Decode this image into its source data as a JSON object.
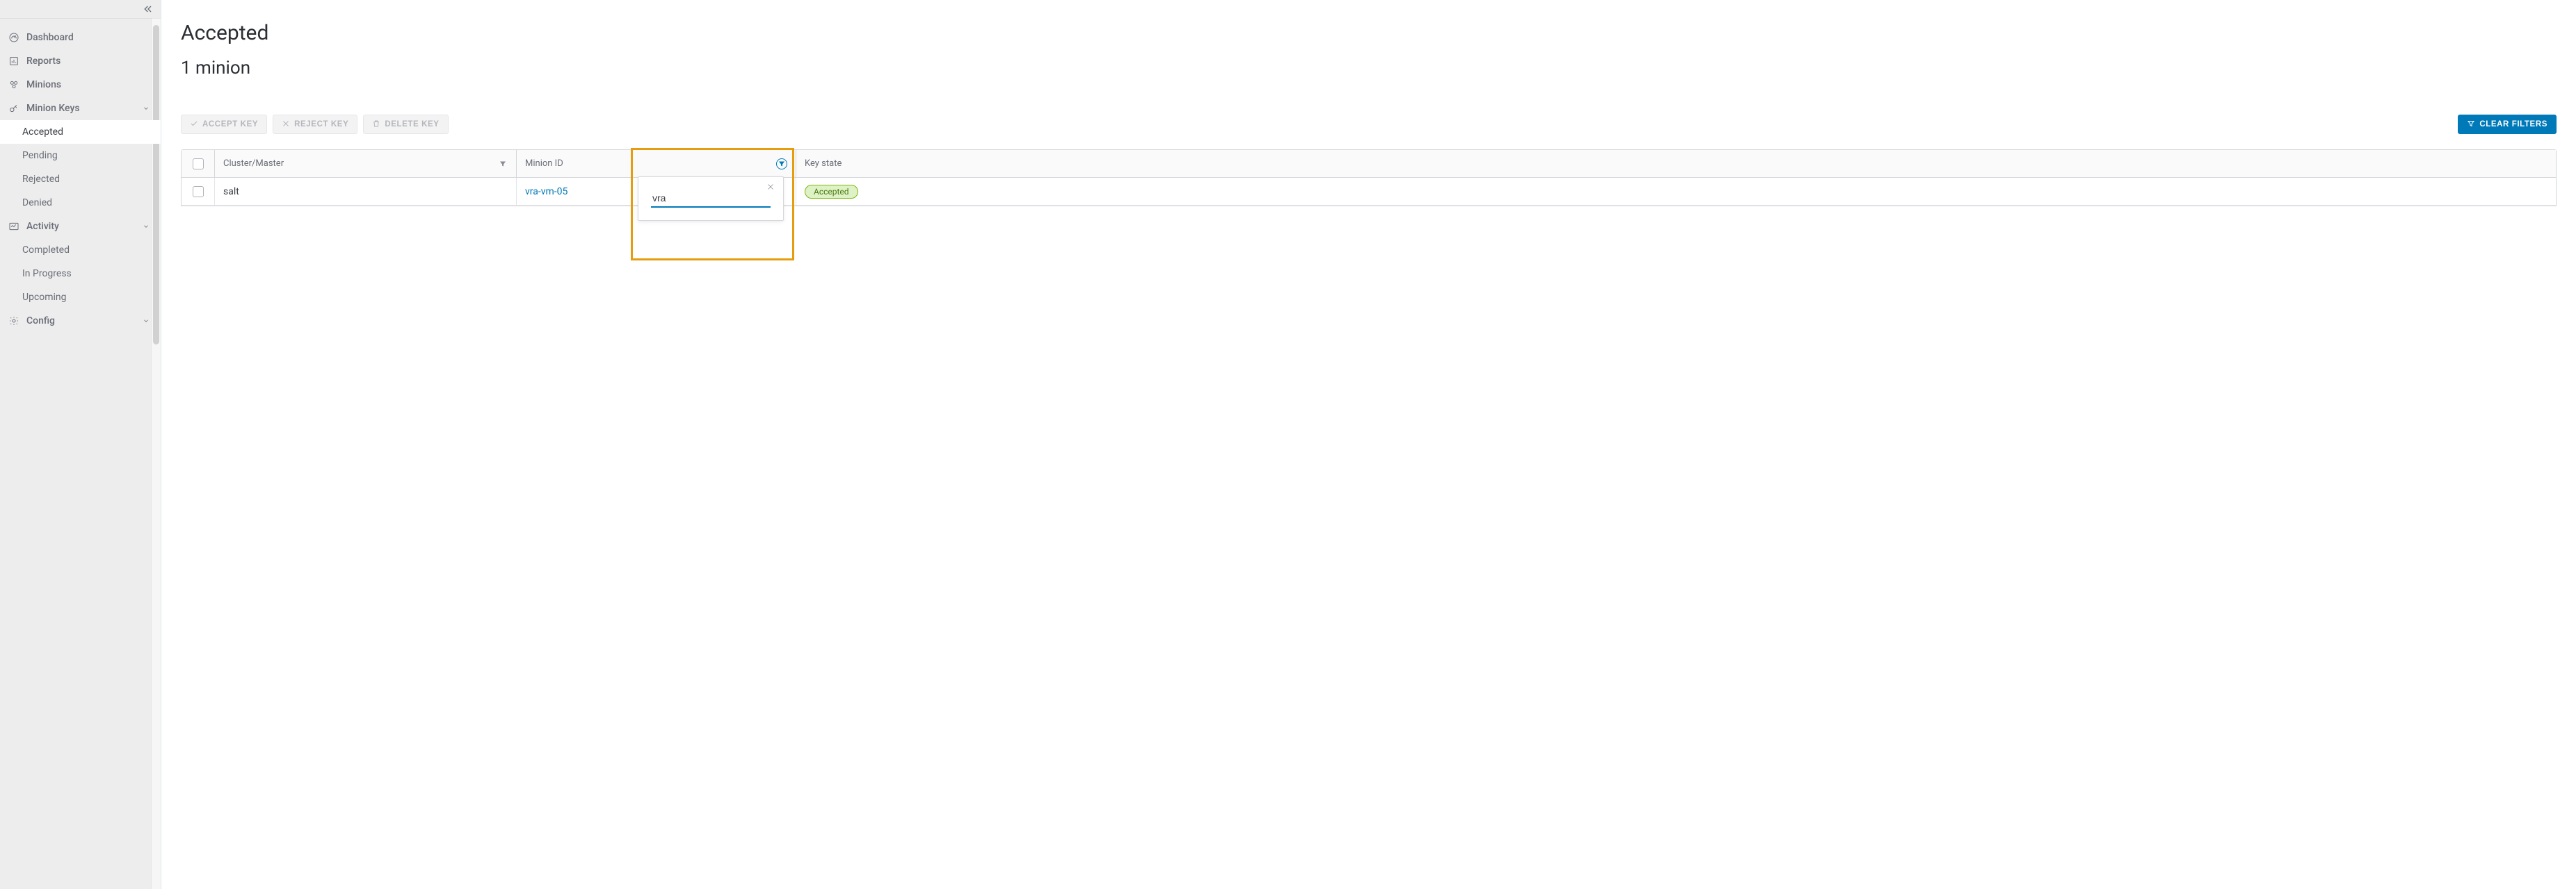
{
  "sidebar": {
    "items": [
      {
        "label": "Dashboard",
        "icon": "gauge"
      },
      {
        "label": "Reports",
        "icon": "report"
      },
      {
        "label": "Minions",
        "icon": "minions"
      },
      {
        "label": "Minion Keys",
        "icon": "key",
        "expandable": true,
        "expanded": true,
        "children": [
          {
            "label": "Accepted",
            "active": true
          },
          {
            "label": "Pending"
          },
          {
            "label": "Rejected"
          },
          {
            "label": "Denied"
          }
        ]
      },
      {
        "label": "Activity",
        "icon": "activity",
        "expandable": true,
        "expanded": true,
        "children": [
          {
            "label": "Completed"
          },
          {
            "label": "In Progress"
          },
          {
            "label": "Upcoming"
          }
        ]
      },
      {
        "label": "Config",
        "icon": "gear",
        "expandable": true,
        "expanded": false
      }
    ]
  },
  "page": {
    "title": "Accepted",
    "subtitle": "1 minion"
  },
  "toolbar": {
    "accept_key": "Accept key",
    "reject_key": "Reject key",
    "delete_key": "Delete key",
    "clear_filters": "Clear filters"
  },
  "table": {
    "columns": {
      "cluster": "Cluster/Master",
      "minion_id": "Minion ID",
      "key_state": "Key state"
    },
    "rows": [
      {
        "cluster": "salt",
        "minion_id": "vra-vm-05",
        "key_state": "Accepted"
      }
    ]
  },
  "filter_popover": {
    "value": "vra"
  }
}
